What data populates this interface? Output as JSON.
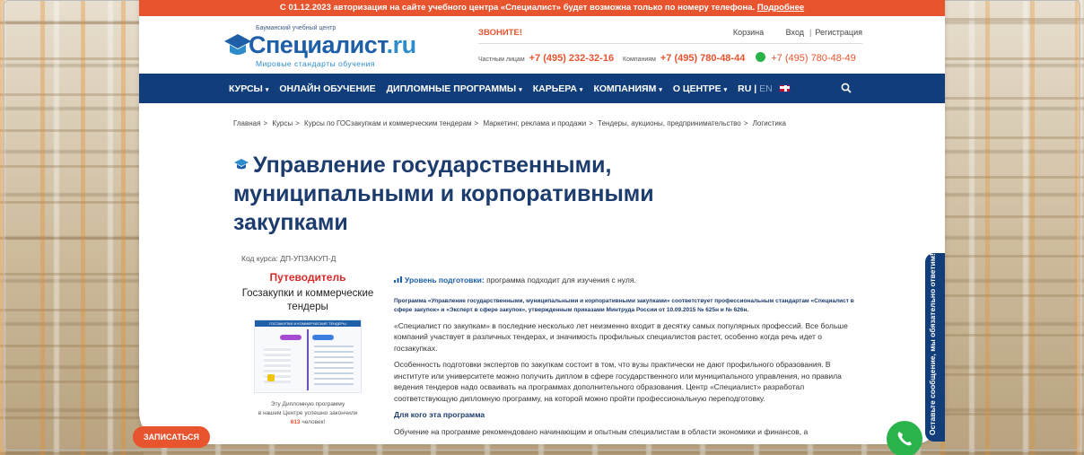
{
  "notice": {
    "text": "С 01.12.2023 авторизация на сайте учебного центра «Специалист» будет возможна только по номеру телефона.",
    "link": "Подробнее"
  },
  "logo": {
    "small": "Бауманский учебный центр",
    "main": "Специалист",
    "suffix": ".ru",
    "tagline": "Мировые стандарты обучения"
  },
  "header": {
    "call_label": "ЗВОНИТЕ!",
    "cart": "Корзина",
    "login": "Вход",
    "register": "Регистрация",
    "private_label": "Частным лицам",
    "private_phone": "+7 (495) 232-32-16",
    "company_label": "Компаниям",
    "company_phone": "+7 (495) 780-48-44",
    "whatsapp_phone": "+7 (495) 780-48-49"
  },
  "nav": {
    "items": [
      {
        "label": "КУРСЫ",
        "chev": "▾"
      },
      {
        "label": "ОНЛАЙН ОБУЧЕНИЕ",
        "chev": ""
      },
      {
        "label": "ДИПЛОМНЫЕ ПРОГРАММЫ",
        "chev": "▾"
      },
      {
        "label": "КАРЬЕРА",
        "chev": "▾"
      },
      {
        "label": "КОМПАНИЯМ",
        "chev": "▾"
      },
      {
        "label": "О ЦЕНТРЕ",
        "chev": "▾"
      }
    ],
    "lang_ru": "RU",
    "lang_sep": "|",
    "lang_en": "EN"
  },
  "breadcrumb": [
    "Главная",
    "Курсы",
    "Курсы по ГОСзакупкам и коммерческим тендерам",
    "Маркетинг, реклама и продажи",
    "Тендеры, аукционы, предпринимательство",
    "Логистика"
  ],
  "breadcrumb_sep": ">",
  "title_lines": [
    "Управление государственными,",
    "муниципальными и корпоративными",
    "закупками"
  ],
  "course_code": "Код курса: ДП-УПЗАКУП-Д",
  "guide": {
    "title": "Путеводитель",
    "subtitle": "Госзакупки и коммерческие тендеры",
    "image_caption": "ГОСЗАКУПКИ И КОММЕРЧЕСКИЕ ТЕНДЕРЫ",
    "note_line1": "Эту Дипломную программу",
    "note_line2": "в нашем Центре успешно закончили",
    "count": "613",
    "count_suffix": "человек!",
    "signup": "ЗАПИСАТЬСЯ"
  },
  "content": {
    "level_label": "Уровень подготовки:",
    "level_text": "программа подходит для изучения с нуля.",
    "standard": "Программа «Управление государственными, муниципальными и корпоративными закупками» соответствует профессиональным стандартам «Специалист в сфере закупок» и «Эксперт в сфере закупок», утвержденным приказами Минтруда России от 10.09.2015 № 625н и № 626н.",
    "para1": "«Специалист по закупкам» в последние несколько лет неизменно входит в десятку самых популярных профессий. Все больше компаний участвует в различных тендерах, и значимость профильных специалистов растет, особенно когда речь идет о госзакупках.",
    "para2": "Особенность подготовки экспертов по закупкам состоит в том, что вузы практически не дают профильного образования. В институте или университете можно получить диплом в сфере государственного или муниципального управления, но правила ведения тендеров надо осваивать на программах дополнительного образования. Центр «Специалист» разработал соответствующую дипломную программу, на которой можно пройти профессиональную переподготовку.",
    "for_whom": "Для кого эта программа",
    "para3": "Обучение на программе рекомендовано начинающим и опытным специалистам в области экономики и финансов, а"
  },
  "side_tab": "Оставьте сообщение, мы обязательно ответим!",
  "colors": {
    "accent": "#e8542e",
    "nav_bg": "#113e7a",
    "title": "#1c3c6e",
    "whatsapp": "#2ab34a"
  },
  "icons": [
    "graduation-cap-icon",
    "search-icon",
    "whatsapp-icon",
    "uk-flag-icon",
    "level-bars-icon"
  ]
}
